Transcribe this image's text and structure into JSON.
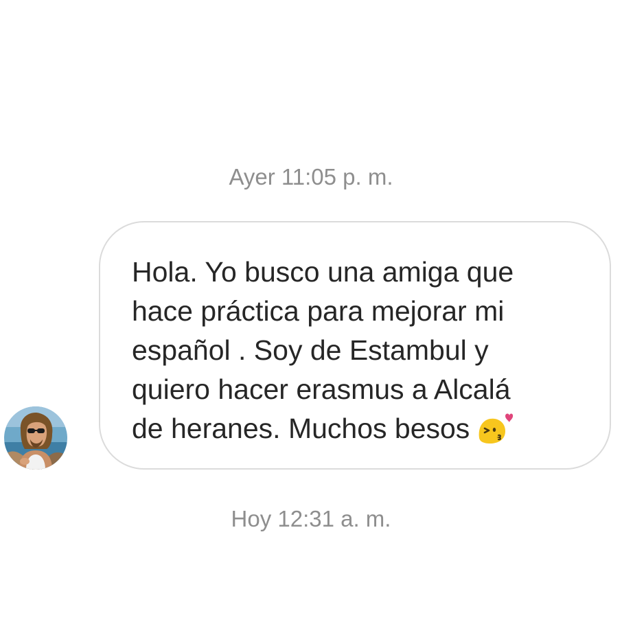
{
  "conversation": {
    "timestamp_top": "Ayer 11:05 p. m.",
    "timestamp_bottom": "Hoy 12:31 a. m.",
    "message": {
      "text": "Hola. Yo busco una amiga que\nhace práctica para mejorar mi\nespañol . Soy de Estambul y\nquiero hacer erasmus a Alcalá\nde heranes. Muchos besos",
      "emoji": "face-blowing-a-kiss-icon"
    },
    "sender": {
      "avatar": "user-avatar"
    }
  },
  "colors": {
    "background": "#ffffff",
    "timestamp": "#8e8e8e",
    "bubble_border": "#dbdbdb",
    "message_text": "#262626",
    "emoji_face": "#f7c61e",
    "emoji_heart": "#e0457b"
  }
}
